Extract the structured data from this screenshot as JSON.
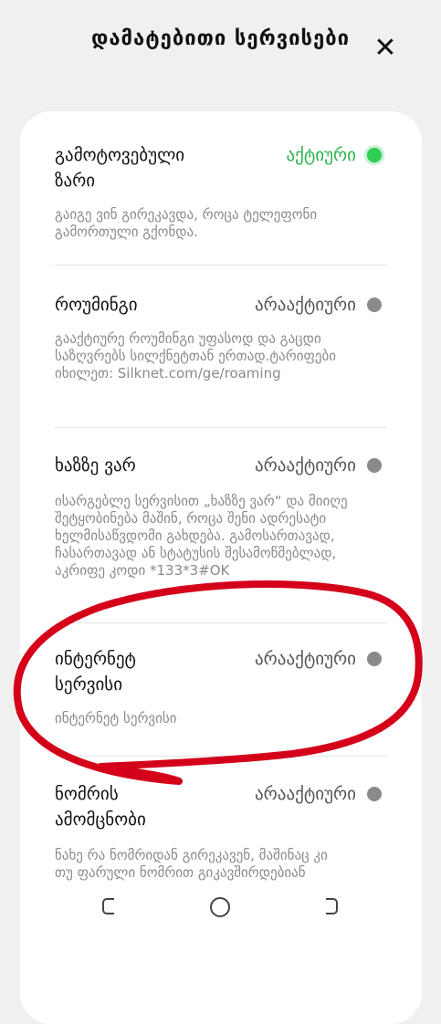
{
  "header": {
    "title": "დამატებითი სერვისები",
    "close_icon": "close-icon"
  },
  "services": [
    {
      "title": "გამოტოვებული ზარი",
      "status": "აქტიური",
      "active": true,
      "description": "გაიგე ვინ გირეკავდა, როცა ტელეფონი გამორთული გქონდა."
    },
    {
      "title": "როუმინგი",
      "status": "არააქტიური",
      "active": false,
      "description": "გააქტიურე როუმინგი უფასოდ და გაცდი საზღვრებს სილქნეტთან ერთად.ტარიფები იხილეთ: Silknet.com/ge/roaming"
    },
    {
      "title": "ხაზზე ვარ",
      "status": "არააქტიური",
      "active": false,
      "description": "ისარგებლე სერვისით „ხაზზე ვარ“ და მიიღე შეტყობინება მაშინ, როცა შენი ადრესატი ხელმისაწვდომი გახდება. გამოსართავად, ჩასართავად ან სტატუსის შესამოწმებლად, აკრიფე კოდი *133*3#OK"
    },
    {
      "title": "ინტერნეტ სერვისი",
      "status": "არააქტიური",
      "active": false,
      "description": "ინტერნეტ სერვისი"
    },
    {
      "title": "ნომრის ამომცნობი",
      "status": "არააქტიური",
      "active": false,
      "description": "ნახე რა ნომრიდან გირეკავენ, მაშინაც კი თუ ფარული ნომრით გიკავშირდებიან"
    }
  ],
  "colors": {
    "active_status": "#2bb24c",
    "inactive_dot": "#8a8a8a",
    "annotation": "#d4001a"
  },
  "navbar": {
    "back": "back-icon",
    "home": "home-icon",
    "recents": "recents-icon"
  }
}
